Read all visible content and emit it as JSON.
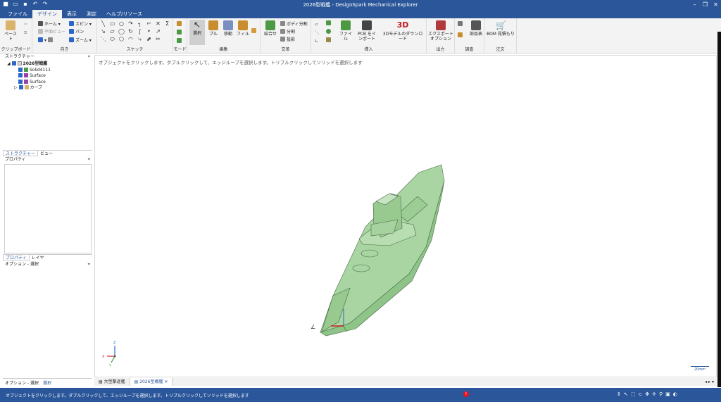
{
  "title": "2026型戦艦 - DesignSpark Mechanical Explorer",
  "tabs": [
    "ファイル",
    "デザイン",
    "表示",
    "測定",
    "ヘルプ/リソース"
  ],
  "groups": {
    "clipboard": "クリップボード",
    "orient": "向き",
    "sketch": "スケッチ",
    "mode": "モード",
    "edit": "編集",
    "intersect": "交差",
    "insert": "挿入",
    "output": "出力",
    "inspect": "調査",
    "order": "注文"
  },
  "clip": {
    "paste": "ペースト"
  },
  "orient": {
    "home": "ホーム",
    "plane": "平面ビュー",
    "spin": "スピン",
    "pan": "パン",
    "zoom": "ズーム"
  },
  "edit": {
    "select": "選択",
    "pull": "プル",
    "move": "移動",
    "fill": "フィル"
  },
  "intersect": {
    "combine": "結合せ",
    "split_body": "ボディ分割",
    "split": "分割",
    "project": "投影"
  },
  "insert": {
    "file": "ファイル",
    "pcb": "PCB をインポート",
    "model3d": "3Dモデルのダウンロード"
  },
  "output": {
    "export": "エクスポートオプション"
  },
  "inspect": {
    "parts": "部品表"
  },
  "order": {
    "bom": "BOM 見積もり"
  },
  "structure": {
    "header": "ストラクチャー",
    "root": "2026型戦艦",
    "items": [
      "Solid4111",
      "Surface",
      "Surface",
      "カーブ"
    ]
  },
  "panel_tabs1": [
    "ストラクチャー",
    "ビュー"
  ],
  "props_header": "プロパティ",
  "panel_tabs2": [
    "プロパティ",
    "レイヤ"
  ],
  "options_header": "オプション - 選択",
  "hint": "オブジェクトをクリックします。ダブルクリックして、エッジループを選択します。トリプルクリックしてソリッドを選択します",
  "scale": "20mm",
  "bottom_left_tabs": [
    "オプション - 選択",
    "選択"
  ],
  "doc_tabs": [
    "大型駆逐艦",
    "2026型戦艦"
  ],
  "status_msg": "オブジェクトをクリックします。ダブルクリックして、エッジループを選択します。トリプルクリックしてソリッドを選択します",
  "colors": {
    "accent": "#2b579a",
    "hull": "#a8d5a2",
    "edge": "#4b6b47"
  }
}
